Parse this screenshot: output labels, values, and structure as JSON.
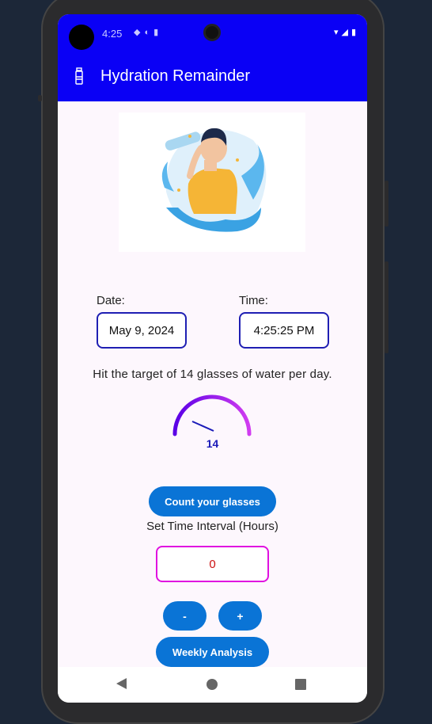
{
  "status_bar": {
    "time": "4:25",
    "notification_icons": [
      "tag-icon",
      "data-saver-icon",
      "sd-card-icon"
    ],
    "system_icons": [
      "wifi-icon",
      "signal-icon",
      "battery-icon"
    ]
  },
  "app_bar": {
    "title": "Hydration Remainder",
    "icon": "bottle-icon"
  },
  "form": {
    "date_label": "Date:",
    "date_value": "May 9, 2024",
    "time_label": "Time:",
    "time_value": "4:25:25 PM"
  },
  "target": {
    "text": "Hit the target of 14 glasses of water per day.",
    "gauge_value": "14",
    "gauge_colors": [
      "#5a00e6",
      "#d13cf0"
    ]
  },
  "buttons": {
    "count": "Count your glasses",
    "minus": "-",
    "plus": "+",
    "weekly": "Weekly Analysis"
  },
  "interval": {
    "label": "Set Time Interval (Hours)",
    "value": "0"
  },
  "colors": {
    "primary": "#0a00f5",
    "button": "#0a74d6",
    "interval_border": "#e010e0"
  }
}
